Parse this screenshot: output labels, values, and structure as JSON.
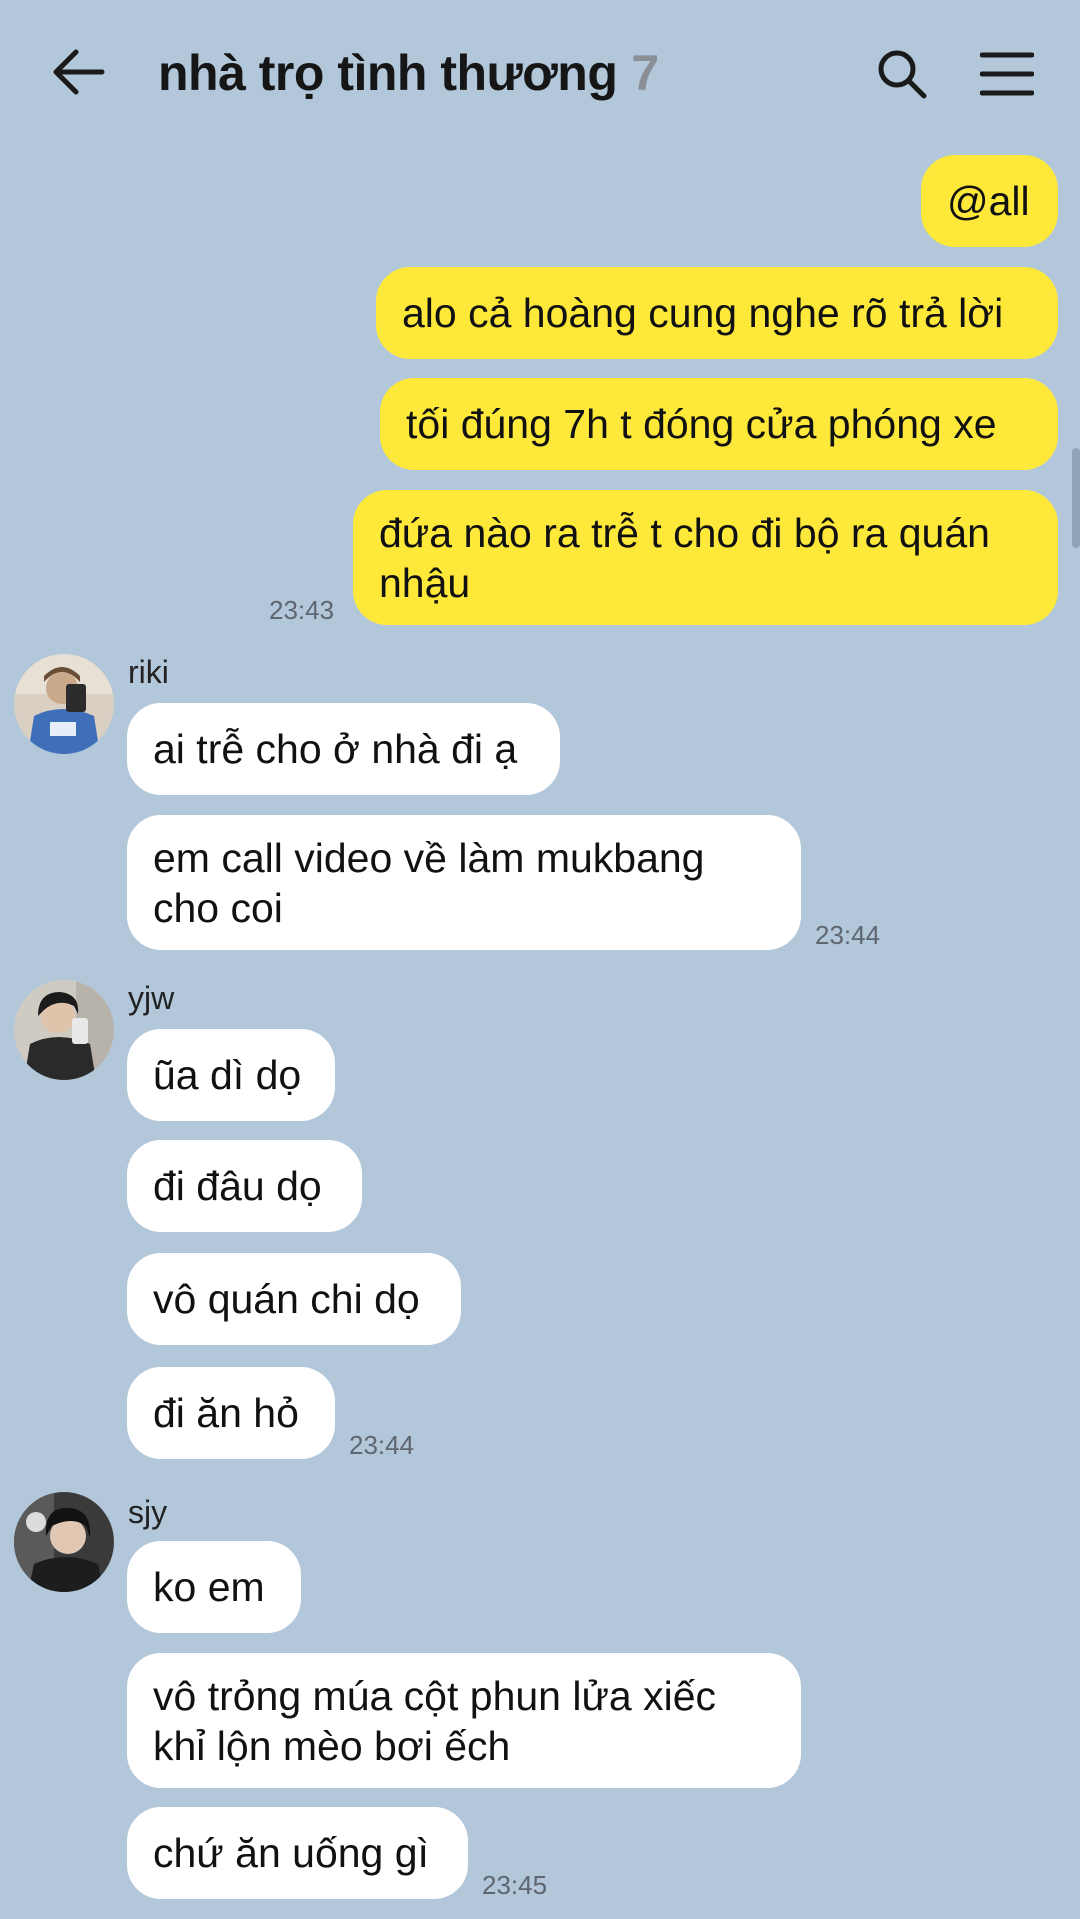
{
  "header": {
    "title": "nhà trọ tình thương",
    "member_count": "7",
    "back_icon": "arrow-left-icon",
    "search_icon": "search-icon",
    "menu_icon": "hamburger-menu-icon"
  },
  "colors": {
    "background": "#b2c7da",
    "my_bubble": "#fee93a",
    "other_bubble": "#ffffff"
  },
  "my_messages": {
    "m1": "@all",
    "m2": "alo cả hoàng cung nghe rõ trả lời",
    "m3": "tối đúng 7h t đóng cửa phóng xe",
    "m4": "đứa nào ra trễ t cho đi bộ ra quán nhậu",
    "time": "23:43"
  },
  "riki": {
    "name": "riki",
    "m1": "ai trễ cho ở nhà đi ạ",
    "m2": "em call video về làm mukbang cho coi",
    "time": "23:44"
  },
  "yjw": {
    "name": "yjw",
    "m1": "ũa dì dọ",
    "m2": "đi đâu dọ",
    "m3": "vô quán chi dọ",
    "m4": "đi ăn hỏ",
    "time": "23:44"
  },
  "sjy": {
    "name": "sjy",
    "m1": "ko em",
    "m2": "vô trỏng múa cột phun lửa xiếc khỉ lộn mèo bơi ếch",
    "m3": "chứ ăn uống gì",
    "time": "23:45"
  }
}
